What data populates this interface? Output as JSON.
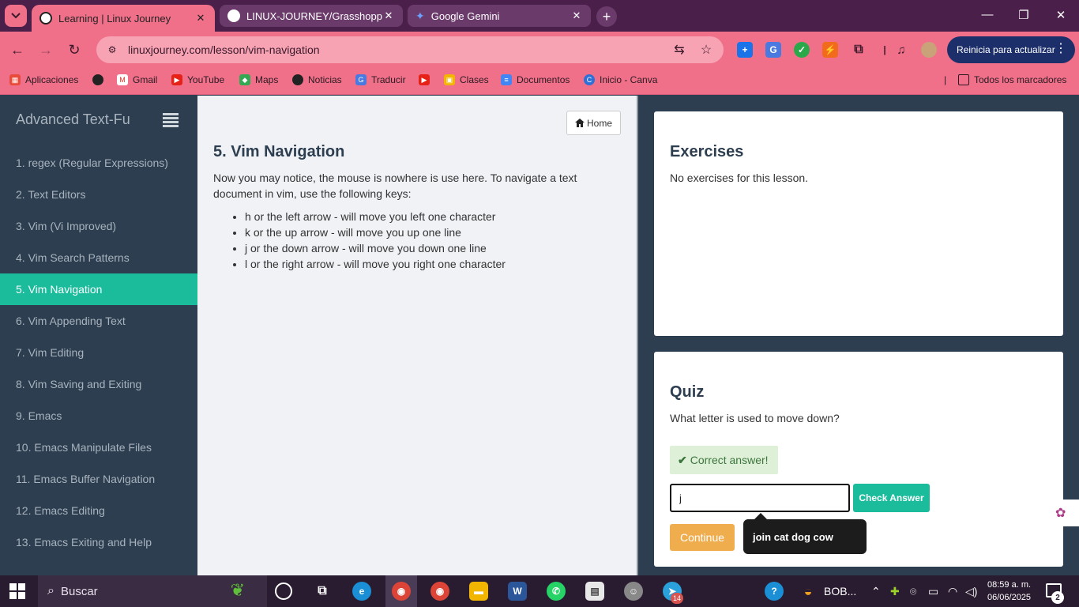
{
  "browser": {
    "tabs": [
      {
        "title": "Learning | Linux Journey",
        "active": true
      },
      {
        "title": "LINUX-JOURNEY/Grasshopper/",
        "active": false
      },
      {
        "title": "Google Gemini",
        "active": false
      }
    ],
    "url": "linuxjourney.com/lesson/vim-navigation",
    "update_button": "Reinicia para actualizar",
    "bookmarks": [
      "Aplicaciones",
      "Gmail",
      "YouTube",
      "Maps",
      "Noticias",
      "Traducir",
      "Clases",
      "Documentos",
      "Inicio - Canva"
    ],
    "all_bookmarks": "Todos los marcadores"
  },
  "sidebar": {
    "title": "Advanced Text-Fu",
    "items": [
      "1. regex (Regular Expressions)",
      "2. Text Editors",
      "3. Vim (Vi Improved)",
      "4. Vim Search Patterns",
      "5. Vim Navigation",
      "6. Vim Appending Text",
      "7. Vim Editing",
      "8. Vim Saving and Exiting",
      "9. Emacs",
      "10. Emacs Manipulate Files",
      "11. Emacs Buffer Navigation",
      "12. Emacs Editing",
      "13. Emacs Exiting and Help"
    ],
    "active_index": 4
  },
  "lesson": {
    "home_label": "Home",
    "title": "5. Vim Navigation",
    "intro": "Now you may notice, the mouse is nowhere is use here. To navigate a text document in vim, use the following keys:",
    "keys": [
      "h or the left arrow - will move you left one character",
      "k or the up arrow - will move you up one line",
      "j or the down arrow - will move you down one line",
      "l or the right arrow - will move you right one character"
    ]
  },
  "exercises": {
    "title": "Exercises",
    "text": "No exercises for this lesson."
  },
  "quiz": {
    "title": "Quiz",
    "question": "What letter is used to move down?",
    "feedback": "Correct answer!",
    "answer_value": "j",
    "check_label": "Check Answer",
    "continue_label": "Continue",
    "tooltip": "join cat dog cow"
  },
  "taskbar": {
    "search_label": "Buscar",
    "tray_text": "BOB...",
    "time": "08:59 a. m.",
    "date": "06/06/2025",
    "telegram_badge": "14",
    "notifications": "2"
  },
  "colors": {
    "accent": "#1abc9c",
    "sidebar_bg": "#2c3e50",
    "browser_chrome": "#f0708a",
    "continue": "#f0ad4e",
    "success_bg": "#dff0d8"
  }
}
